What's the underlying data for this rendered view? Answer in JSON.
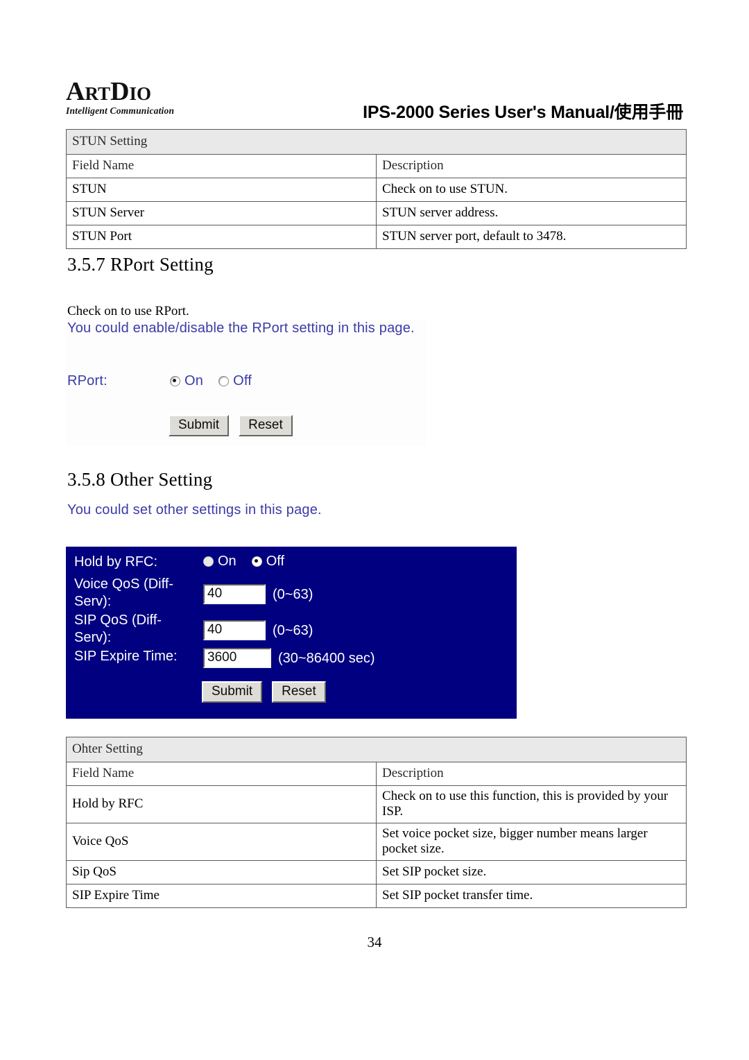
{
  "header": {
    "logo_main_art": "A",
    "logo_main_rt": "RT",
    "logo_main_d": "D",
    "logo_main_io": "IO",
    "logo_text": "ARTDIO",
    "logo_tagline": "Intelligent Communication",
    "manual_title": "IPS-2000 Series User's Manual/使用手冊"
  },
  "stun_table": {
    "band_label": "STUN Setting",
    "columns": [
      "Field Name",
      "Description"
    ],
    "rows": [
      {
        "field": "STUN",
        "description": "Check on to use STUN."
      },
      {
        "field": "STUN Server",
        "description": "STUN server address."
      },
      {
        "field": "STUN Port",
        "description": "STUN server port, default to 3478."
      }
    ]
  },
  "rport_section": {
    "heading": "3.5.7 RPort Setting",
    "note": "Check on to use RPort.",
    "intro": "You could enable/disable the RPort setting in this page.",
    "field_label": "RPort:",
    "option_on": "On",
    "option_off": "Off",
    "selected": "On",
    "submit_label": "Submit",
    "reset_label": "Reset"
  },
  "other_section": {
    "heading": "3.5.8 Other Setting",
    "intro": "You could set other settings in this page.",
    "hold_label": "Hold by RFC:",
    "option_on": "On",
    "option_off": "Off",
    "hold_selected": "Off",
    "voice_label_line1": "Voice QoS (Diff-",
    "voice_label_line2": "Serv):",
    "voice_value": "40",
    "voice_range": "(0~63)",
    "sip_qos_label_line1": "SIP QoS (Diff-",
    "sip_qos_label_line2": "Serv):",
    "sip_qos_value": "40",
    "sip_qos_range": "(0~63)",
    "expire_label": "SIP Expire Time:",
    "expire_value": "3600",
    "expire_range": "(30~86400 sec)",
    "submit_label": "Submit",
    "reset_label": "Reset",
    "panel_color": "#000080"
  },
  "other_table": {
    "band_label": "Ohter Setting",
    "columns": [
      "Field Name",
      "Description"
    ],
    "rows": [
      {
        "field": "Hold by RFC",
        "description": "Check on to use this function, this is provided by your ISP."
      },
      {
        "field": "Voice QoS",
        "description": "Set voice pocket size, bigger number means larger pocket size."
      },
      {
        "field": "Sip QoS",
        "description": "Set SIP pocket size."
      },
      {
        "field": "SIP Expire Time",
        "description": "Set SIP pocket transfer time."
      }
    ]
  },
  "footer": {
    "page_number": "34"
  }
}
